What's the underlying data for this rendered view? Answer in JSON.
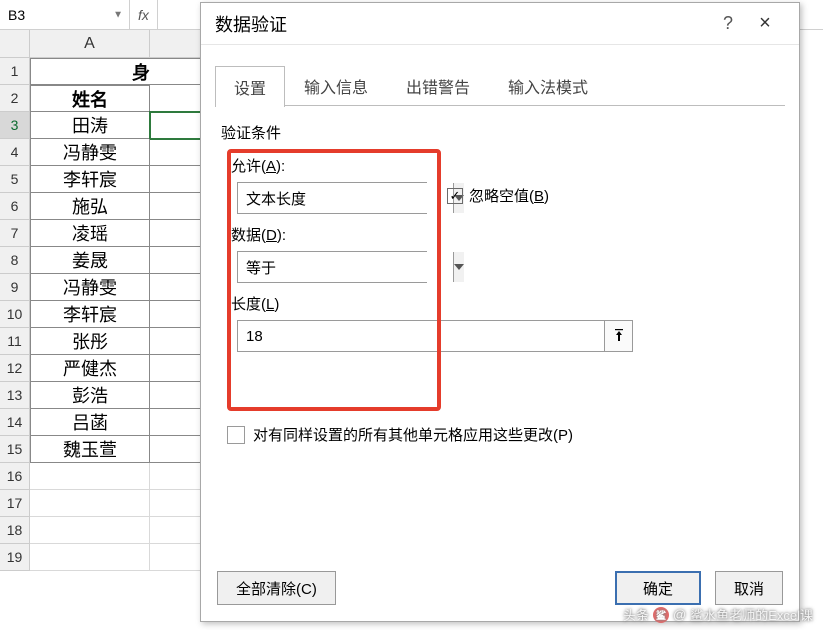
{
  "namebox": {
    "value": "B3",
    "fx_label": "fx"
  },
  "columns": {
    "A": "A"
  },
  "rows": {
    "header1": "身",
    "header_name": "姓名",
    "data": [
      "田涛",
      "冯静雯",
      "李轩宸",
      "施弘",
      "凌瑶",
      "姜晟",
      "冯静雯",
      "李轩宸",
      "张彤",
      "严健杰",
      "彭浩",
      "吕菡",
      "魏玉萱"
    ]
  },
  "row_numbers": [
    "1",
    "2",
    "3",
    "4",
    "5",
    "6",
    "7",
    "8",
    "9",
    "10",
    "11",
    "12",
    "13",
    "14",
    "15",
    "16",
    "17",
    "18",
    "19"
  ],
  "dialog": {
    "title": "数据验证",
    "help": "?",
    "close": "×",
    "tabs": {
      "settings": "设置",
      "input_msg": "输入信息",
      "error_alert": "出错警告",
      "ime": "输入法模式"
    },
    "group_label": "验证条件",
    "allow_label_pre": "允许(",
    "allow_label_u": "A",
    "allow_label_post": "):",
    "allow_value": "文本长度",
    "ignore_blank_label_pre": "忽略空值(",
    "ignore_blank_u": "B",
    "ignore_blank_label_post": ")",
    "ignore_blank_checked": "✓",
    "data_label_pre": "数据(",
    "data_label_u": "D",
    "data_label_post": "):",
    "data_value": "等于",
    "length_label_pre": "长度(",
    "length_label_u": "L",
    "length_label_post": ")",
    "length_value": "18",
    "apply_all_label": "对有同样设置的所有其他单元格应用这些更改(P)",
    "clear_all": "全部清除(C)",
    "ok": "确定",
    "cancel": "取消"
  },
  "watermark": {
    "prefix": "头条",
    "at": "@",
    "text": "鲨水鱼老师的Excel课"
  }
}
